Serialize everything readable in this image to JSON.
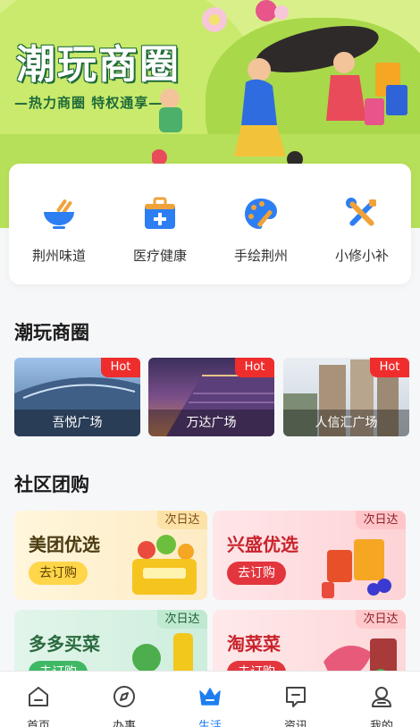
{
  "hero": {
    "title": "潮玩商圈",
    "subtitle": "—热力商圈 特权通享—"
  },
  "categories": [
    {
      "label": "荆州味道",
      "icon": "bowl-icon"
    },
    {
      "label": "医疗健康",
      "icon": "medical-kit-icon"
    },
    {
      "label": "手绘荆州",
      "icon": "palette-icon"
    },
    {
      "label": "小修小补",
      "icon": "tools-icon"
    }
  ],
  "sections": {
    "malls_title": "潮玩商圈",
    "groupbuy_title": "社区团购"
  },
  "malls": [
    {
      "name": "吾悦广场",
      "badge": "Hot"
    },
    {
      "name": "万达广场",
      "badge": "Hot"
    },
    {
      "name": "人信汇广场",
      "badge": "Hot"
    }
  ],
  "groupbuy": [
    {
      "name": "美团优选",
      "tag": "次日达",
      "button": "去订购"
    },
    {
      "name": "兴盛优选",
      "tag": "次日达",
      "button": "去订购"
    },
    {
      "name": "多多买菜",
      "tag": "次日达",
      "button": "去订购"
    },
    {
      "name": "淘菜菜",
      "tag": "次日达",
      "button": "去订购"
    }
  ],
  "tabs": [
    {
      "label": "首页",
      "icon": "home-icon"
    },
    {
      "label": "办事",
      "icon": "compass-icon"
    },
    {
      "label": "生活",
      "icon": "crown-icon",
      "active": true
    },
    {
      "label": "资讯",
      "icon": "message-icon"
    },
    {
      "label": "我的",
      "icon": "user-icon"
    }
  ],
  "colors": {
    "accent": "#1e7ef0",
    "hot": "#ef2d2d",
    "hero_green": "#1e6b3a"
  }
}
